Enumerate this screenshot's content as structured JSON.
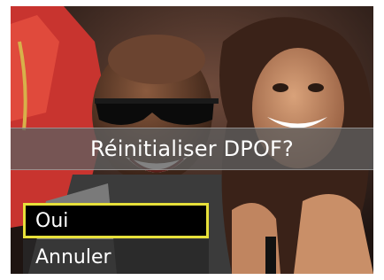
{
  "dialog": {
    "question": "Réinitialiser DPOF?",
    "options": [
      {
        "label": "Oui",
        "selected": true
      },
      {
        "label": "Annuler",
        "selected": false
      }
    ]
  },
  "colors": {
    "selection_border": "#e7e03a",
    "banner_bg": "#5f5f5f",
    "text": "#ffffff"
  }
}
